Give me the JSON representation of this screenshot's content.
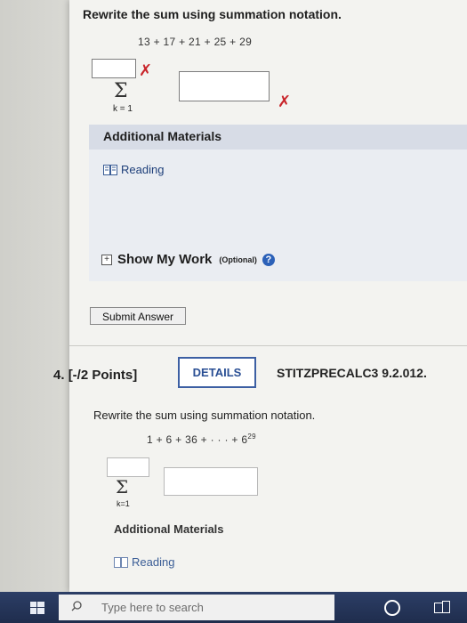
{
  "q3": {
    "prompt": "Rewrite the sum using summation notation.",
    "expression": "13 + 17 + 21 + 25 + 29",
    "sigma": "Σ",
    "lower_index": "k = 1",
    "upper_value": "",
    "term_value": "",
    "mark_upper": "✗",
    "mark_term": "✗"
  },
  "materials": {
    "header": "Additional Materials",
    "reading_label": "Reading"
  },
  "show_work": {
    "label": "Show My Work",
    "optional": "(Optional)",
    "help": "?",
    "toggle": "+"
  },
  "submit": {
    "label": "Submit Answer"
  },
  "q4": {
    "number": "4.",
    "points": "[-/2 Points]",
    "details_label": "DETAILS",
    "course_code": "STITZPRECALC3 9.2.012.",
    "prompt": "Rewrite the sum using summation notation.",
    "expression_main": "1 + 6 + 36 + · · · + 6",
    "expression_exp": "29",
    "sigma": "Σ",
    "lower_index": "k=1",
    "upper_value": "",
    "term_value": "",
    "materials_header": "Additional Materials",
    "reading_label": "Reading"
  },
  "taskbar": {
    "search_placeholder": "Type here to search"
  },
  "colors": {
    "wrong_mark": "#c8242a",
    "link": "#1e3f7a",
    "details_border": "#3c5fa3",
    "taskbar": "#1f2d4d"
  },
  "icons": [
    "windows-logo-icon",
    "search-icon",
    "book-icon",
    "help-icon",
    "cortana-icon",
    "task-view-icon"
  ]
}
